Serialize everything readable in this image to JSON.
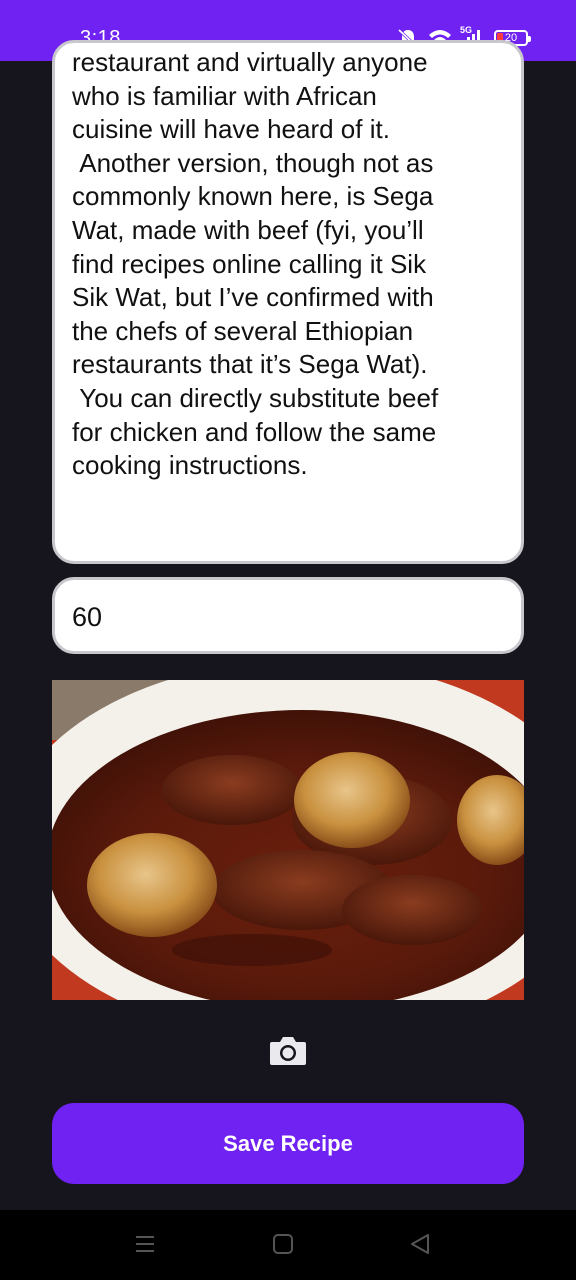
{
  "status_bar": {
    "time": "3:18",
    "network": "5G",
    "battery": "20",
    "icons": [
      "mute-bell-icon",
      "wifi-icon",
      "signal-icon",
      "battery-icon"
    ]
  },
  "form": {
    "description": "restaurant and virtually anyone\nwho is familiar with African\ncuisine will have heard of it.\n Another version, though not as\ncommonly known here, is Sega\nWat, made with beef (fyi, you’ll\nfind recipes online calling it Sik\nSik Wat, but I’ve confirmed with\nthe chefs of several Ethiopian\nrestaurants that it’s Sega Wat).\n You can directly substitute beef\nfor chicken and follow the same\ncooking instructions.",
    "time_value": "60",
    "save_label": "Save Recipe"
  },
  "colors": {
    "accent": "#6f22f2",
    "background": "#16141c"
  }
}
